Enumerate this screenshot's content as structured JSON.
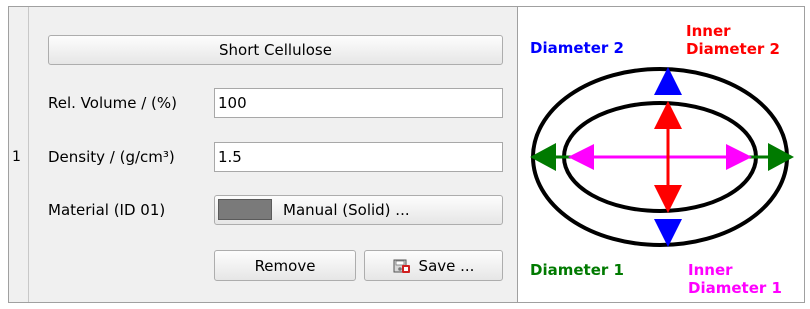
{
  "table": {
    "row_number": "1"
  },
  "panel": {
    "name_button": "Short Cellulose",
    "rel_volume": {
      "label": "Rel. Volume / (%)",
      "value": "100"
    },
    "density": {
      "label": "Density / (g/cm³)",
      "value": "1.5"
    },
    "material": {
      "label": "Material (ID 01)",
      "button": "Manual (Solid) ..."
    },
    "remove_button": "Remove",
    "save_button": "Save ..."
  },
  "diagram": {
    "labels": {
      "diameter_2": "Diameter 2",
      "inner_diameter_2_line1": "Inner",
      "inner_diameter_2_line2": "Diameter 2",
      "diameter_1": "Diameter 1",
      "inner_diameter_1_line1": "Inner",
      "inner_diameter_1_line2": "Diameter 1"
    },
    "colors": {
      "diameter_1": "#007a00",
      "diameter_2": "#0000ff",
      "inner_diameter_1": "#ff00ff",
      "inner_diameter_2": "#ff0000"
    }
  }
}
